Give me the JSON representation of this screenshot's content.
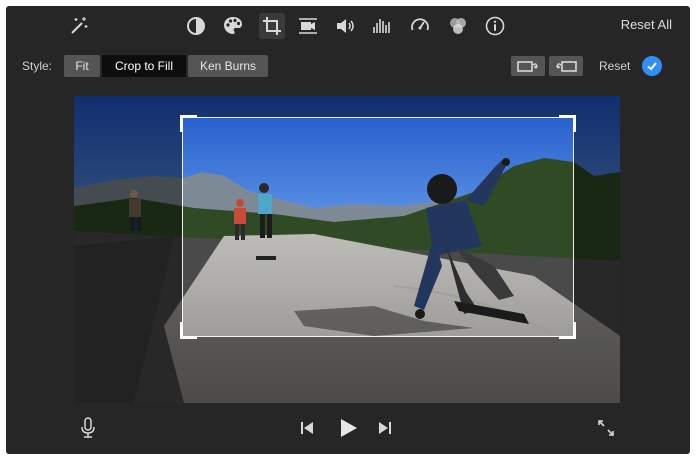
{
  "toolbar": {
    "icons": [
      {
        "name": "magic-wand-icon"
      },
      {
        "name": "color-balance-icon"
      },
      {
        "name": "color-correction-icon"
      },
      {
        "name": "crop-icon",
        "active": true
      },
      {
        "name": "stabilization-icon"
      },
      {
        "name": "volume-icon"
      },
      {
        "name": "noise-reduction-icon"
      },
      {
        "name": "speed-icon"
      },
      {
        "name": "clip-filter-icon"
      },
      {
        "name": "info-icon"
      }
    ],
    "reset_all_label": "Reset All"
  },
  "style_row": {
    "label": "Style:",
    "options": [
      "Fit",
      "Crop to Fill",
      "Ken Burns"
    ],
    "selected": "Crop to Fill",
    "reset_label": "Reset",
    "accent_color": "#2f8ff5"
  },
  "viewer": {
    "content": "video-frame"
  },
  "playback": {
    "icons": [
      "microphone-icon",
      "skip-back-icon",
      "play-icon",
      "skip-forward-icon",
      "fullscreen-icon"
    ]
  }
}
